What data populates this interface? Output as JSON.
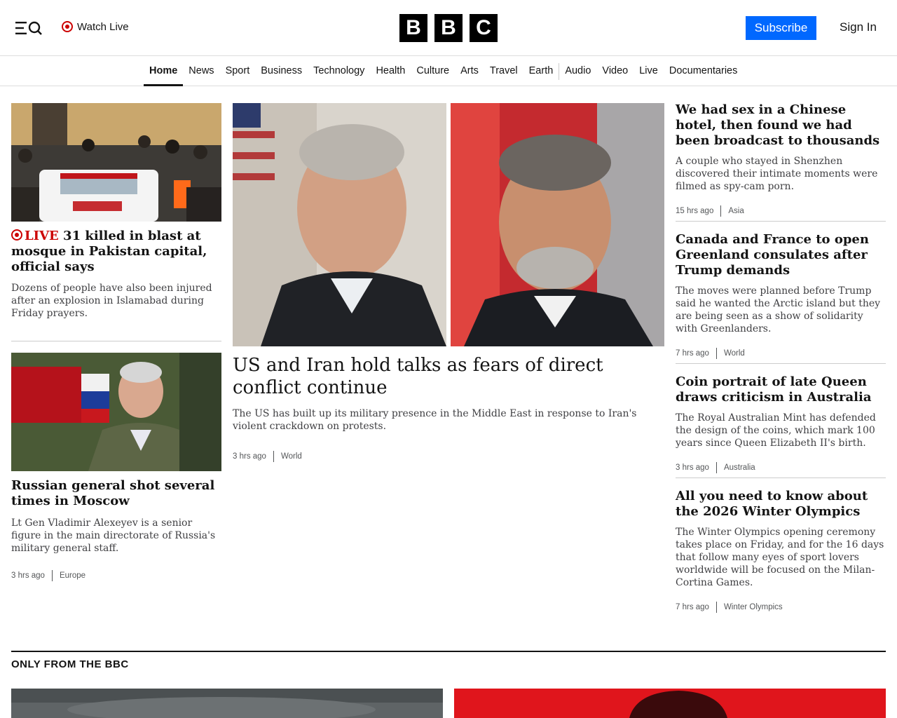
{
  "header": {
    "watch_live": "Watch Live",
    "logo_letters": [
      "B",
      "B",
      "C"
    ],
    "subscribe": "Subscribe",
    "sign_in": "Sign In"
  },
  "nav": {
    "items": [
      "Home",
      "News",
      "Sport",
      "Business",
      "Technology",
      "Health",
      "Culture",
      "Arts",
      "Travel",
      "Earth",
      "Audio",
      "Video",
      "Live",
      "Documentaries"
    ],
    "active": "Home"
  },
  "left": {
    "story1": {
      "live_label": "LIVE",
      "headline": "31 killed in blast at mosque in Pakistan capital, official says",
      "summary": "Dozens of people have also been injured after an explosion in Islamabad during Friday prayers."
    },
    "story2": {
      "headline": "Russian general shot several times in Moscow",
      "summary": "Lt Gen Vladimir Alexeyev is a senior figure in the main directorate of Russia's military general staff.",
      "time": "3 hrs ago",
      "category": "Europe"
    }
  },
  "main": {
    "headline": "US and Iran hold talks as fears of direct conflict continue",
    "summary": "The US has built up its military presence in the Middle East in response to Iran's violent crackdown on protests.",
    "time": "3 hrs ago",
    "category": "World"
  },
  "right": [
    {
      "headline": "We had sex in a Chinese hotel, then found we had been broadcast to thousands",
      "summary": "A couple who stayed in Shenzhen discovered their intimate moments were filmed as spy-cam porn.",
      "time": "15 hrs ago",
      "category": "Asia"
    },
    {
      "headline": "Canada and France to open Greenland consulates after Trump demands",
      "summary": "The moves were planned before Trump said he wanted the Arctic island but they are being seen as a show of solidarity with Greenlanders.",
      "time": "7 hrs ago",
      "category": "World"
    },
    {
      "headline": "Coin portrait of late Queen draws criticism in Australia",
      "summary": "The Royal Australian Mint has defended the design of the coins, which mark 100 years since Queen Elizabeth II's birth.",
      "time": "3 hrs ago",
      "category": "Australia"
    },
    {
      "headline": "All you need to know about the 2026 Winter Olympics",
      "summary": "The Winter Olympics opening ceremony takes place on Friday, and for the 16 days that follow many eyes of sport lovers worldwide will be focused on the Milan-Cortina Games.",
      "time": "7 hrs ago",
      "category": "Winter Olympics"
    }
  ],
  "section": {
    "title": "ONLY FROM THE BBC"
  },
  "colors": {
    "subscribe": "#0068ff",
    "live_red": "#c00000",
    "text": "#141414"
  }
}
